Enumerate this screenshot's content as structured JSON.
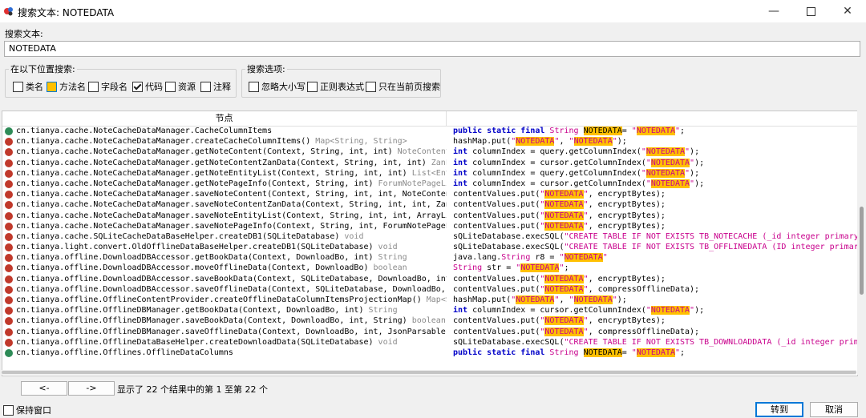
{
  "window": {
    "title": "搜索文本: NOTEDATA"
  },
  "search": {
    "label": "搜索文本:",
    "value": "NOTEDATA"
  },
  "location_group": {
    "legend": "在以下位置搜索:",
    "options": [
      {
        "label": "类名",
        "checked": false
      },
      {
        "label": "方法名",
        "checked": false
      },
      {
        "label": "字段名",
        "checked": false
      },
      {
        "label": "代码",
        "checked": true
      },
      {
        "label": "资源",
        "checked": false
      },
      {
        "label": "注释",
        "checked": false
      }
    ]
  },
  "options_group": {
    "legend": "搜索选项:",
    "options": [
      {
        "label": "忽略大小写",
        "checked": false
      },
      {
        "label": "正则表达式",
        "checked": false
      },
      {
        "label": "只在当前页搜索",
        "checked": false
      }
    ]
  },
  "results": {
    "header": "节点",
    "rows": [
      {
        "icon": "field",
        "node": "cn.tianya.cache.NoteCacheDataManager.CacheColumnItems",
        "type": "",
        "code": [
          [
            "kw",
            "public static final "
          ],
          [
            "str",
            "String "
          ],
          [
            "hl",
            "NOTEDATA"
          ],
          [
            "",
            "= "
          ],
          [
            "str",
            "\""
          ],
          [
            "strhl",
            "NOTEDATA"
          ],
          [
            "str",
            "\""
          ],
          [
            "",
            ";"
          ]
        ]
      },
      {
        "icon": "method",
        "node": "cn.tianya.cache.NoteCacheDataManager.createCacheColumnItems()",
        "type": "Map<String, String>",
        "code": [
          [
            "",
            "hashMap.put("
          ],
          [
            "str",
            "\""
          ],
          [
            "strhl",
            "NOTEDATA"
          ],
          [
            "str",
            "\""
          ],
          [
            "",
            ", "
          ],
          [
            "str",
            "\""
          ],
          [
            "strhl",
            "NOTEDATA"
          ],
          [
            "str",
            "\""
          ],
          [
            "",
            ");"
          ]
        ]
      },
      {
        "icon": "method",
        "node": "cn.tianya.cache.NoteCacheDataManager.getNoteContent(Context, String, int, int)",
        "type": "NoteContent",
        "code": [
          [
            "kw",
            "int "
          ],
          [
            "",
            "columnIndex = query.getColumnIndex("
          ],
          [
            "str",
            "\""
          ],
          [
            "strhl",
            "NOTEDATA"
          ],
          [
            "str",
            "\""
          ],
          [
            "",
            ");"
          ]
        ]
      },
      {
        "icon": "method",
        "node": "cn.tianya.cache.NoteCacheDataManager.getNoteContentZanData(Context, String, int, int)",
        "type": "ZanL",
        "code": [
          [
            "kw",
            "int "
          ],
          [
            "",
            "columnIndex = cursor.getColumnIndex("
          ],
          [
            "str",
            "\""
          ],
          [
            "strhl",
            "NOTEDATA"
          ],
          [
            "str",
            "\""
          ],
          [
            "",
            ");"
          ]
        ]
      },
      {
        "icon": "method",
        "node": "cn.tianya.cache.NoteCacheDataManager.getNoteEntityList(Context, String, int, int)",
        "type": "List<Ent",
        "code": [
          [
            "kw",
            "int "
          ],
          [
            "",
            "columnIndex = query.getColumnIndex("
          ],
          [
            "str",
            "\""
          ],
          [
            "strhl",
            "NOTEDATA"
          ],
          [
            "str",
            "\""
          ],
          [
            "",
            ");"
          ]
        ]
      },
      {
        "icon": "method",
        "node": "cn.tianya.cache.NoteCacheDataManager.getNotePageInfo(Context, String, int)",
        "type": "ForumNotePageLi",
        "code": [
          [
            "kw",
            "int "
          ],
          [
            "",
            "columnIndex = cursor.getColumnIndex("
          ],
          [
            "str",
            "\""
          ],
          [
            "strhl",
            "NOTEDATA"
          ],
          [
            "str",
            "\""
          ],
          [
            "",
            ");"
          ]
        ]
      },
      {
        "icon": "method",
        "node": "cn.tianya.cache.NoteCacheDataManager.saveNoteContent(Context, String, int, int, NoteConten",
        "type": "",
        "code": [
          [
            "",
            "contentValues.put("
          ],
          [
            "str",
            "\""
          ],
          [
            "strhl",
            "NOTEDATA"
          ],
          [
            "str",
            "\""
          ],
          [
            "",
            ", encryptBytes);"
          ]
        ]
      },
      {
        "icon": "method",
        "node": "cn.tianya.cache.NoteCacheDataManager.saveNoteContentZanData(Context, String, int, int, Zan",
        "type": "",
        "code": [
          [
            "",
            "contentValues.put("
          ],
          [
            "str",
            "\""
          ],
          [
            "strhl",
            "NOTEDATA"
          ],
          [
            "str",
            "\""
          ],
          [
            "",
            ", encryptBytes);"
          ]
        ]
      },
      {
        "icon": "method",
        "node": "cn.tianya.cache.NoteCacheDataManager.saveNoteEntityList(Context, String, int, int, ArrayLi",
        "type": "",
        "code": [
          [
            "",
            "contentValues.put("
          ],
          [
            "str",
            "\""
          ],
          [
            "strhl",
            "NOTEDATA"
          ],
          [
            "str",
            "\""
          ],
          [
            "",
            ", encryptBytes);"
          ]
        ]
      },
      {
        "icon": "method",
        "node": "cn.tianya.cache.NoteCacheDataManager.saveNotePageInfo(Context, String, int, ForumNotePageL",
        "type": "",
        "code": [
          [
            "",
            "contentValues.put("
          ],
          [
            "str",
            "\""
          ],
          [
            "strhl",
            "NOTEDATA"
          ],
          [
            "str",
            "\""
          ],
          [
            "",
            ", encryptBytes);"
          ]
        ]
      },
      {
        "icon": "method",
        "node": "cn.tianya.cache.SQLiteCacheDataBaseHelper.createDB1(SQLiteDatabase)",
        "type": "void",
        "code": [
          [
            "",
            "sQLiteDatabase.execSQL("
          ],
          [
            "str",
            "\"CREATE TABLE IF NOT EXISTS TB_NOTECACHE (_id integer primary"
          ]
        ]
      },
      {
        "icon": "method",
        "node": "cn.tianya.light.convert.OldOfflineDataBaseHelper.createDB1(SQLiteDatabase)",
        "type": "void",
        "code": [
          [
            "",
            "sQLiteDatabase.execSQL("
          ],
          [
            "str",
            "\"CREATE TABLE IF NOT EXISTS TB_OFFLINEDATA (ID integer primary"
          ]
        ]
      },
      {
        "icon": "method",
        "node": "cn.tianya.offline.DownloadDBAccessor.getBookData(Context, DownloadBo, int)",
        "type": "String",
        "code": [
          [
            "",
            "java.lang."
          ],
          [
            "str",
            "String "
          ],
          [
            "",
            "r8 = "
          ],
          [
            "str",
            "\""
          ],
          [
            "strhl",
            "NOTEDATA"
          ],
          [
            "str",
            "\""
          ]
        ]
      },
      {
        "icon": "method",
        "node": "cn.tianya.offline.DownloadDBAccessor.moveOfflineData(Context, DownloadBo)",
        "type": "boolean",
        "code": [
          [
            "str",
            "String "
          ],
          [
            "",
            "str = "
          ],
          [
            "str",
            "\""
          ],
          [
            "strhl",
            "NOTEDATA"
          ],
          [
            "str",
            "\""
          ],
          [
            "",
            ";"
          ]
        ]
      },
      {
        "icon": "method",
        "node": "cn.tianya.offline.DownloadDBAccessor.saveBookData(Context, SQLiteDatabase, DownloadBo, int",
        "type": "",
        "code": [
          [
            "",
            "contentValues.put("
          ],
          [
            "str",
            "\""
          ],
          [
            "strhl",
            "NOTEDATA"
          ],
          [
            "str",
            "\""
          ],
          [
            "",
            ", encryptBytes);"
          ]
        ]
      },
      {
        "icon": "method",
        "node": "cn.tianya.offline.DownloadDBAccessor.saveOfflineData(Context, SQLiteDatabase, DownloadBo,",
        "type": "",
        "code": [
          [
            "",
            "contentValues.put("
          ],
          [
            "str",
            "\""
          ],
          [
            "strhl",
            "NOTEDATA"
          ],
          [
            "str",
            "\""
          ],
          [
            "",
            ", compressOfflineData);"
          ]
        ]
      },
      {
        "icon": "method",
        "node": "cn.tianya.offline.OfflineContentProvider.createOfflineDataColumnItemsProjectionMap()",
        "type": "Map<St",
        "code": [
          [
            "",
            "hashMap.put("
          ],
          [
            "str",
            "\""
          ],
          [
            "strhl",
            "NOTEDATA"
          ],
          [
            "str",
            "\""
          ],
          [
            "",
            ", "
          ],
          [
            "str",
            "\""
          ],
          [
            "strhl",
            "NOTEDATA"
          ],
          [
            "str",
            "\""
          ],
          [
            "",
            ");"
          ]
        ]
      },
      {
        "icon": "method",
        "node": "cn.tianya.offline.OfflineDBManager.getBookData(Context, DownloadBo, int)",
        "type": "String",
        "code": [
          [
            "kw",
            "int "
          ],
          [
            "",
            "columnIndex = cursor.getColumnIndex("
          ],
          [
            "str",
            "\""
          ],
          [
            "strhl",
            "NOTEDATA"
          ],
          [
            "str",
            "\""
          ],
          [
            "",
            ");"
          ]
        ]
      },
      {
        "icon": "method",
        "node": "cn.tianya.offline.OfflineDBManager.saveBookData(Context, DownloadBo, int, String)",
        "type": "boolean",
        "code": [
          [
            "",
            "contentValues.put("
          ],
          [
            "str",
            "\""
          ],
          [
            "strhl",
            "NOTEDATA"
          ],
          [
            "str",
            "\""
          ],
          [
            "",
            ", encryptBytes);"
          ]
        ]
      },
      {
        "icon": "method",
        "node": "cn.tianya.offline.OfflineDBManager.saveOfflineData(Context, DownloadBo, int, JsonParsable)",
        "type": "",
        "code": [
          [
            "",
            "contentValues.put("
          ],
          [
            "str",
            "\""
          ],
          [
            "strhl",
            "NOTEDATA"
          ],
          [
            "str",
            "\""
          ],
          [
            "",
            ", compressOfflineData);"
          ]
        ]
      },
      {
        "icon": "method",
        "node": "cn.tianya.offline.OfflineDataBaseHelper.createDownloadData(SQLiteDatabase)",
        "type": "void",
        "code": [
          [
            "",
            "sQLiteDatabase.execSQL("
          ],
          [
            "str",
            "\"CREATE TABLE IF NOT EXISTS TB_DOWNLOADDATA (_id integer prima"
          ]
        ]
      },
      {
        "icon": "field",
        "node": "cn.tianya.offline.Offlines.OfflineDataColumns",
        "type": "",
        "code": [
          [
            "kw",
            "public static final "
          ],
          [
            "str",
            "String "
          ],
          [
            "hl",
            "NOTEDATA"
          ],
          [
            "",
            "= "
          ],
          [
            "str",
            "\""
          ],
          [
            "strhl",
            "NOTEDATA"
          ],
          [
            "str",
            "\""
          ],
          [
            "",
            ";"
          ]
        ]
      }
    ]
  },
  "pager": {
    "prev_label": "<-",
    "next_label": "->",
    "status": "显示了 22 个结果中的第 1 至第 22 个"
  },
  "footer": {
    "keep_window_label": "保持窗口",
    "goto_label": "转到",
    "cancel_label": "取消"
  },
  "colors": {
    "keyword": "#0000c8",
    "string": "#c8008c",
    "highlight": "#ffc000",
    "field_icon": "#2e8b57",
    "method_icon": "#c0392b"
  }
}
